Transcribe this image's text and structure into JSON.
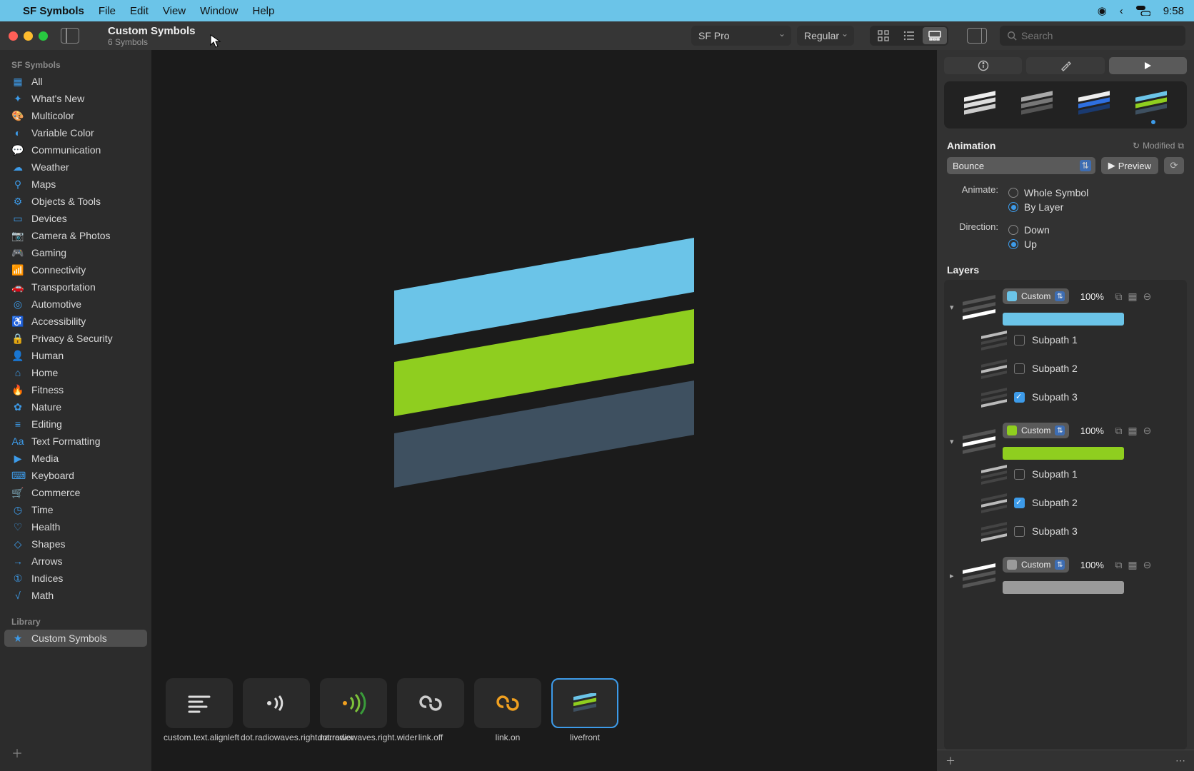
{
  "menubar": {
    "app": "SF Symbols",
    "items": [
      "File",
      "Edit",
      "View",
      "Window",
      "Help"
    ],
    "clock": "9:58"
  },
  "titlebar": {
    "title": "Custom Symbols",
    "subtitle": "6 Symbols",
    "font_select": "SF Pro",
    "weight_select": "Regular",
    "search_placeholder": "Search"
  },
  "sidebar": {
    "heading1": "SF Symbols",
    "items": [
      {
        "icon": "grid",
        "label": "All"
      },
      {
        "icon": "sparkle",
        "label": "What's New"
      },
      {
        "icon": "palette",
        "label": "Multicolor"
      },
      {
        "icon": "variable",
        "label": "Variable Color"
      },
      {
        "icon": "bubble",
        "label": "Communication"
      },
      {
        "icon": "cloud",
        "label": "Weather"
      },
      {
        "icon": "map",
        "label": "Maps"
      },
      {
        "icon": "cube",
        "label": "Objects & Tools"
      },
      {
        "icon": "display",
        "label": "Devices"
      },
      {
        "icon": "camera",
        "label": "Camera & Photos"
      },
      {
        "icon": "game",
        "label": "Gaming"
      },
      {
        "icon": "wifi",
        "label": "Connectivity"
      },
      {
        "icon": "car",
        "label": "Transportation"
      },
      {
        "icon": "steering",
        "label": "Automotive"
      },
      {
        "icon": "accessibility",
        "label": "Accessibility"
      },
      {
        "icon": "lock",
        "label": "Privacy & Security"
      },
      {
        "icon": "person",
        "label": "Human"
      },
      {
        "icon": "house",
        "label": "Home"
      },
      {
        "icon": "flame",
        "label": "Fitness"
      },
      {
        "icon": "leaf",
        "label": "Nature"
      },
      {
        "icon": "slider",
        "label": "Editing"
      },
      {
        "icon": "text",
        "label": "Text Formatting"
      },
      {
        "icon": "play",
        "label": "Media"
      },
      {
        "icon": "keyboard",
        "label": "Keyboard"
      },
      {
        "icon": "cart",
        "label": "Commerce"
      },
      {
        "icon": "clock",
        "label": "Time"
      },
      {
        "icon": "heart",
        "label": "Health"
      },
      {
        "icon": "shapes",
        "label": "Shapes"
      },
      {
        "icon": "arrow",
        "label": "Arrows"
      },
      {
        "icon": "index",
        "label": "Indices"
      },
      {
        "icon": "fx",
        "label": "Math"
      }
    ],
    "heading2": "Library",
    "library_item": "Custom Symbols"
  },
  "thumbnails": [
    {
      "label": "custom.text.alignleft",
      "selected": false,
      "kind": "textalign"
    },
    {
      "label": "dot.radiowaves.right.narrower",
      "selected": false,
      "kind": "radiowave-narrow"
    },
    {
      "label": "dot.radiowaves.right.wider",
      "selected": false,
      "kind": "radiowave-wide"
    },
    {
      "label": "link.off",
      "selected": false,
      "kind": "link-off"
    },
    {
      "label": "link.on",
      "selected": false,
      "kind": "link-on"
    },
    {
      "label": "livefront",
      "selected": true,
      "kind": "livefront"
    }
  ],
  "inspector": {
    "animation_label": "Animation",
    "modified": "Modified",
    "anim_select": "Bounce",
    "preview_btn": "Preview",
    "animate_label": "Animate:",
    "animate_opts": [
      "Whole Symbol",
      "By Layer"
    ],
    "animate_sel": 1,
    "direction_label": "Direction:",
    "direction_opts": [
      "Down",
      "Up"
    ],
    "direction_sel": 1,
    "layers_label": "Layers",
    "layers": [
      {
        "color": "#6bc4e8",
        "mode": "Custom",
        "opacity": "100%",
        "expanded": true,
        "highlight": 2,
        "subpaths": [
          {
            "label": "Subpath 1",
            "on": false
          },
          {
            "label": "Subpath 2",
            "on": false
          },
          {
            "label": "Subpath 3",
            "on": true
          }
        ]
      },
      {
        "color": "#8fce1f",
        "mode": "Custom",
        "opacity": "100%",
        "expanded": true,
        "highlight": 1,
        "subpaths": [
          {
            "label": "Subpath 1",
            "on": false
          },
          {
            "label": "Subpath 2",
            "on": true
          },
          {
            "label": "Subpath 3",
            "on": false
          }
        ]
      },
      {
        "color": "#9a9a9a",
        "mode": "Custom",
        "opacity": "100%",
        "expanded": false,
        "highlight": 0,
        "subpaths": []
      }
    ]
  }
}
